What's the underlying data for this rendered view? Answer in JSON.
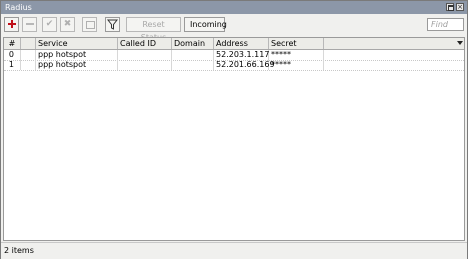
{
  "window": {
    "title": "Radius"
  },
  "toolbar": {
    "add_icon": "plus-icon",
    "remove_icon": "minus-icon",
    "enable_icon": "check-icon",
    "disable_icon": "cross-icon",
    "comment_icon": "comment-icon",
    "filter_icon": "filter-icon",
    "reset_status_label": "Reset Status",
    "incoming_label": "Incoming",
    "find_placeholder": "Find"
  },
  "table": {
    "columns": [
      "#",
      "",
      "Service",
      "Called ID",
      "Domain",
      "Address",
      "Secret"
    ],
    "rows": [
      {
        "num": "0",
        "service": "ppp hotspot",
        "called_id": "",
        "domain": "",
        "address": "52.203.1.117",
        "secret": "*****"
      },
      {
        "num": "1",
        "service": "ppp hotspot",
        "called_id": "",
        "domain": "",
        "address": "52.201.66.169",
        "secret": "*****"
      }
    ]
  },
  "status": {
    "items_text": "2 items"
  },
  "colors": {
    "titlebar": "#8c97a8",
    "add_red": "#c0101a"
  }
}
